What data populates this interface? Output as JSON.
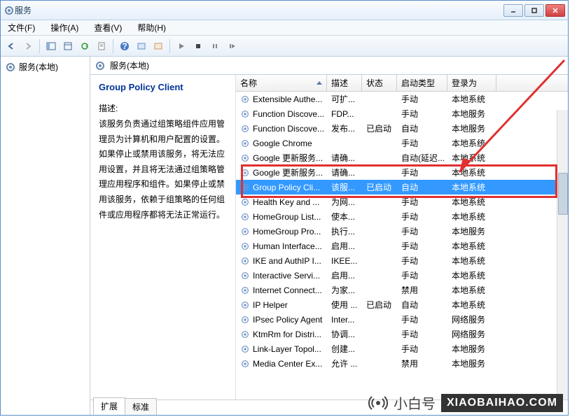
{
  "title": "服务",
  "menu": {
    "file": "文件(F)",
    "action": "操作(A)",
    "view": "查看(V)",
    "help": "帮助(H)"
  },
  "tree": {
    "root": "服务(本地)"
  },
  "rheader": "服务(本地)",
  "detail": {
    "title": "Group Policy Client",
    "label": "描述:",
    "text": "该服务负责通过组策略组件应用管理员为计算机和用户配置的设置。如果停止或禁用该服务，将无法应用设置，并且将无法通过组策略管理应用程序和组件。如果停止或禁用该服务，依赖于组策略的任何组件或应用程序都将无法正常运行。"
  },
  "columns": {
    "name": "名称",
    "desc": "描述",
    "status": "状态",
    "start": "启动类型",
    "logon": "登录为"
  },
  "rows": [
    {
      "name": "Extensible Authe...",
      "desc": "可扩...",
      "status": "",
      "start": "手动",
      "logon": "本地系统"
    },
    {
      "name": "Function Discove...",
      "desc": "FDP...",
      "status": "",
      "start": "手动",
      "logon": "本地服务"
    },
    {
      "name": "Function Discove...",
      "desc": "发布...",
      "status": "已启动",
      "start": "自动",
      "logon": "本地服务"
    },
    {
      "name": "Google Chrome",
      "desc": "",
      "status": "",
      "start": "手动",
      "logon": "本地系统"
    },
    {
      "name": "Google 更新服务...",
      "desc": "请确...",
      "status": "",
      "start": "自动(延迟...",
      "logon": "本地系统"
    },
    {
      "name": "Google 更新服务...",
      "desc": "请确...",
      "status": "",
      "start": "手动",
      "logon": "本地系统"
    },
    {
      "name": "Group Policy Cli...",
      "desc": "该服...",
      "status": "已启动",
      "start": "自动",
      "logon": "本地系统",
      "selected": true
    },
    {
      "name": "Health Key and ...",
      "desc": "为网...",
      "status": "",
      "start": "手动",
      "logon": "本地系统"
    },
    {
      "name": "HomeGroup List...",
      "desc": "使本...",
      "status": "",
      "start": "手动",
      "logon": "本地系统"
    },
    {
      "name": "HomeGroup Pro...",
      "desc": "执行...",
      "status": "",
      "start": "手动",
      "logon": "本地服务"
    },
    {
      "name": "Human Interface...",
      "desc": "启用...",
      "status": "",
      "start": "手动",
      "logon": "本地系统"
    },
    {
      "name": "IKE and AuthIP I...",
      "desc": "IKEE...",
      "status": "",
      "start": "手动",
      "logon": "本地系统"
    },
    {
      "name": "Interactive Servi...",
      "desc": "启用...",
      "status": "",
      "start": "手动",
      "logon": "本地系统"
    },
    {
      "name": "Internet Connect...",
      "desc": "为家...",
      "status": "",
      "start": "禁用",
      "logon": "本地系统"
    },
    {
      "name": "IP Helper",
      "desc": "使用 ...",
      "status": "已启动",
      "start": "自动",
      "logon": "本地系统"
    },
    {
      "name": "IPsec Policy Agent",
      "desc": "Inter...",
      "status": "",
      "start": "手动",
      "logon": "网络服务"
    },
    {
      "name": "KtmRm for Distri...",
      "desc": "协调...",
      "status": "",
      "start": "手动",
      "logon": "网络服务"
    },
    {
      "name": "Link-Layer Topol...",
      "desc": "创建...",
      "status": "",
      "start": "手动",
      "logon": "本地服务"
    },
    {
      "name": "Media Center Ex...",
      "desc": "允许 ...",
      "status": "",
      "start": "禁用",
      "logon": "本地服务"
    }
  ],
  "tabs": {
    "ext": "扩展",
    "std": "标准"
  },
  "watermark": {
    "brand": "小白号",
    "url": "XIAOBAIHAO.COM"
  }
}
